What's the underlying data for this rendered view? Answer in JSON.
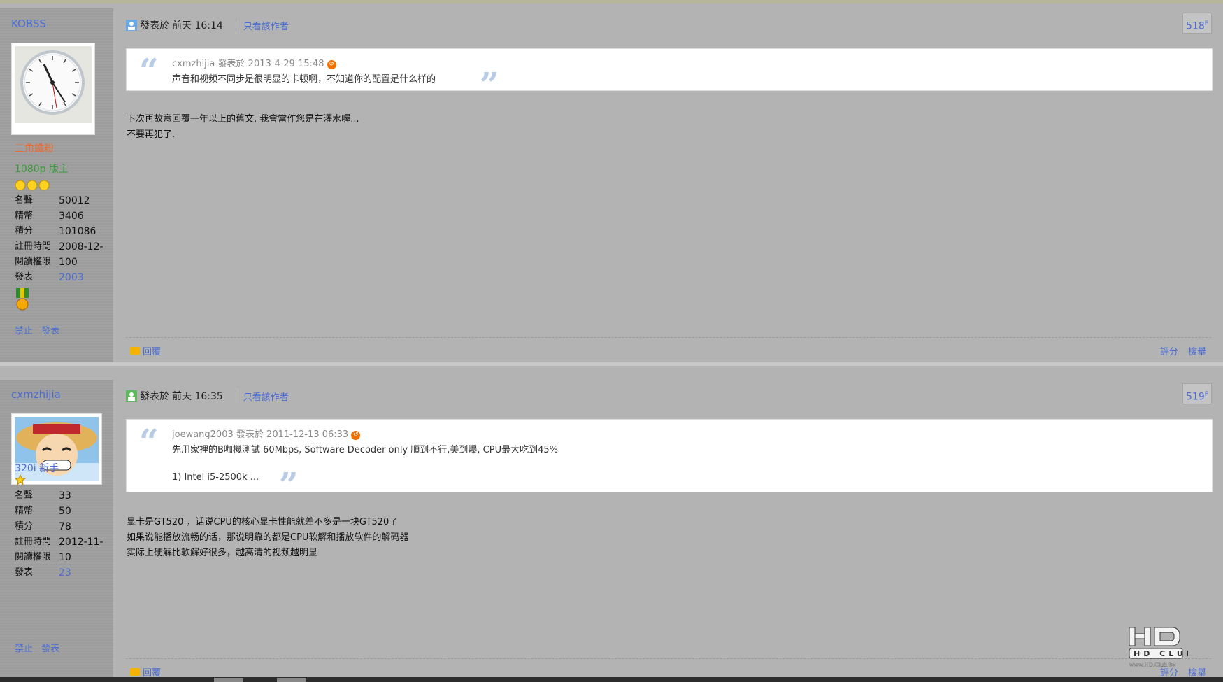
{
  "posts": [
    {
      "username": "KOBSS",
      "title": "三角鐵粉",
      "group": "1080p 版主",
      "stats": [
        {
          "k": "名聲",
          "v": "50012"
        },
        {
          "k": "精幣",
          "v": "3406"
        },
        {
          "k": "積分",
          "v": "101086"
        },
        {
          "k": "註冊時間",
          "v": "2008-12-"
        },
        {
          "k": "閱讀權限",
          "v": "100"
        },
        {
          "k": "發表",
          "v": "2003"
        }
      ],
      "ban_links": "禁止 發表",
      "posted_label": "發表於",
      "posted_time": "前天 16:14",
      "only_author": "只看該作者",
      "floor": "518",
      "floor_suffix": "F",
      "quote": {
        "author": "cxmzhijia",
        "posted_label": "發表於",
        "time": "2013-4-29 15:48",
        "lines": [
          "声音和视频不同步是很明显的卡顿啊，不知道你的配置是什么样的"
        ]
      },
      "message": [
        "下次再故意回覆一年以上的舊文, 我會當作您是在灌水喔...",
        "不要再犯了."
      ],
      "reply": "回覆",
      "rate": "評分",
      "report": "檢舉"
    },
    {
      "username": "cxmzhijia",
      "group": "320i 新手",
      "stats": [
        {
          "k": "名聲",
          "v": "33"
        },
        {
          "k": "精幣",
          "v": "50"
        },
        {
          "k": "積分",
          "v": "78"
        },
        {
          "k": "註冊時間",
          "v": "2012-11-"
        },
        {
          "k": "閱讀權限",
          "v": "10"
        },
        {
          "k": "發表",
          "v": "23"
        }
      ],
      "ban_links": "禁止 發表",
      "posted_label": "發表於",
      "posted_time": "前天 16:35",
      "only_author": "只看該作者",
      "floor": "519",
      "floor_suffix": "F",
      "quote": {
        "author": "joewang2003",
        "posted_label": "發表於",
        "time": "2011-12-13 06:33",
        "lines": [
          "先用家裡的B咖機測試 60Mbps, Software Decoder only 順到不行,美到爆, CPU最大吃到45%",
          "",
          "1) Intel i5-2500k ..."
        ]
      },
      "message": [
        "显卡是GT520 ，话说CPU的核心显卡性能就差不多是一块GT520了",
        "如果说能播放流畅的话，那说明靠的都是CPU软解和播放软件的解码器",
        "实际上硬解比软解好很多，越高清的视频越明显"
      ],
      "reply": "回覆",
      "rate": "評分",
      "report": "檢舉"
    }
  ],
  "watermark": {
    "text": "HD CLUB",
    "sub": "www.HD.Club.tw"
  },
  "colors": {
    "link": "#4a6cd4",
    "title_orange": "#ee6a2a",
    "group_green": "#3a9a3a"
  }
}
